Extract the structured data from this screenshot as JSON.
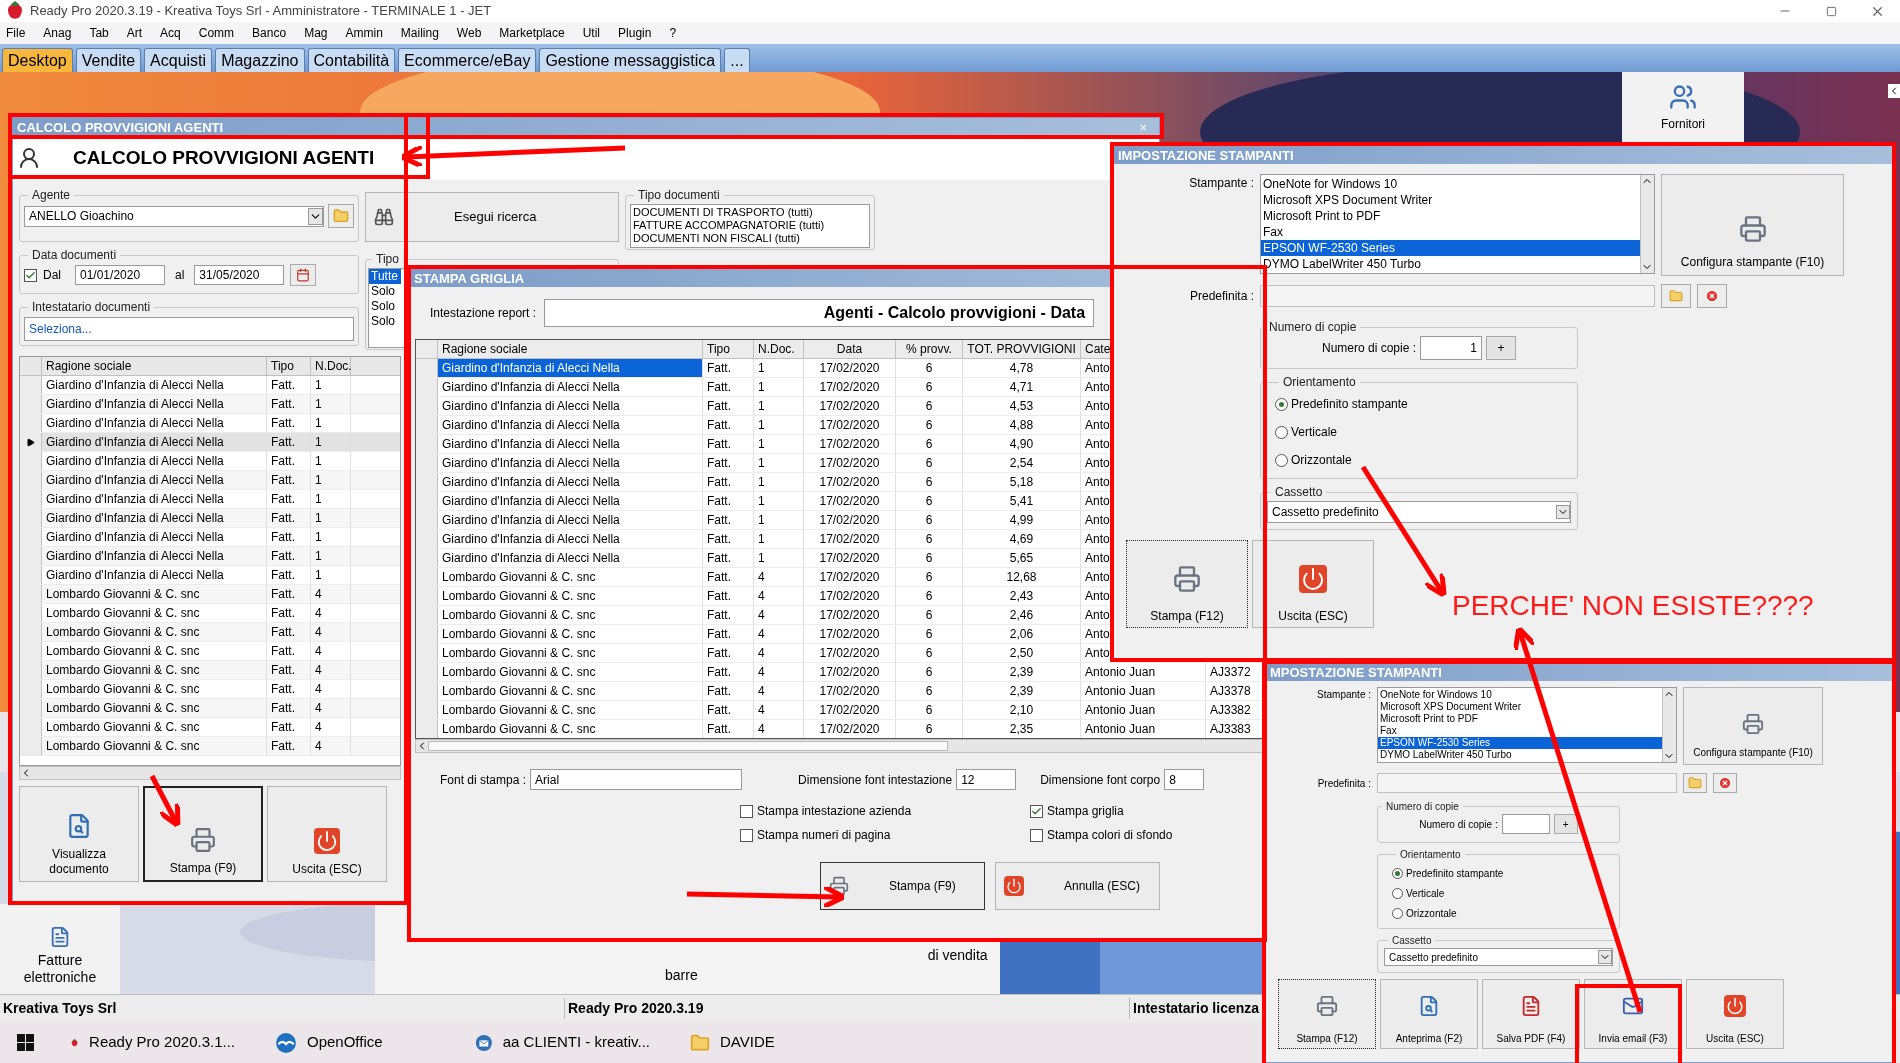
{
  "app_title": "Ready Pro 2020.3.19 - Kreativa Toys Srl - Amministratore - TERMINALE 1 - JET",
  "menu": [
    "File",
    "Anag",
    "Tab",
    "Art",
    "Acq",
    "Comm",
    "Banco",
    "Mag",
    "Ammin",
    "Mailing",
    "Web",
    "Marketplace",
    "Util",
    "Plugin",
    "?"
  ],
  "tabs": [
    {
      "label": "Desktop",
      "selected": true
    },
    {
      "label": "Vendite",
      "selected": false
    },
    {
      "label": "Acquisti",
      "selected": false
    },
    {
      "label": "Magazzino",
      "selected": false
    },
    {
      "label": "Contabilità",
      "selected": false
    },
    {
      "label": "Ecommerce/eBay",
      "selected": false
    },
    {
      "label": "Gestione messaggistica",
      "selected": false
    },
    {
      "label": "...",
      "selected": false
    }
  ],
  "desktop_shortcuts": [
    {
      "label": "Fornitori",
      "kind": "suppliers"
    },
    {
      "label": "Fatture elettroniche",
      "kind": "invoices"
    }
  ],
  "desktop_labels": [
    "barre",
    "di vendita"
  ],
  "agent_window": {
    "title": "CALCOLO PROVVIGIONI AGENTI",
    "close": "×",
    "heading": "CALCOLO PROVVIGIONI AGENTI",
    "agent_group": "Agente",
    "agent_value": "ANELLO Gioachino",
    "search_button": "Esegui ricerca",
    "doc_types_group": "Tipo documenti",
    "doc_types": [
      "DOCUMENTI DI TRASPORTO (tutti)",
      "FATTURE ACCOMPAGNATORIE (tutti)",
      "DOCUMENTI NON FISCALI (tutti)"
    ],
    "date_group": "Data documenti",
    "date_from_label": "Dal",
    "date_from_checked": true,
    "date_from": "01/01/2020",
    "date_to_label": "al",
    "date_to": "31/05/2020",
    "type_group": "Tipo",
    "types": [
      {
        "label": "Tutte",
        "selected": true
      },
      {
        "label": "Solo",
        "selected": false
      },
      {
        "label": "Solo",
        "selected": false
      },
      {
        "label": "Solo",
        "selected": false
      }
    ],
    "holder_group": "Intestatario documenti",
    "holder_placeholder": "Seleziona...",
    "grid": {
      "columns": [
        "Ragione sociale",
        "Tipo",
        "N.Doc."
      ],
      "rows": [
        {
          "cells": [
            "Giardino d'Infanzia di Alecci Nella",
            "Fatt.",
            "1"
          ],
          "selected": false
        },
        {
          "cells": [
            "Giardino d'Infanzia di Alecci Nella",
            "Fatt.",
            "1"
          ],
          "selected": false
        },
        {
          "cells": [
            "Giardino d'Infanzia di Alecci Nella",
            "Fatt.",
            "1"
          ],
          "selected": false
        },
        {
          "cells": [
            "Giardino d'Infanzia di Alecci Nella",
            "Fatt.",
            "1"
          ],
          "selected": true
        },
        {
          "cells": [
            "Giardino d'Infanzia di Alecci Nella",
            "Fatt.",
            "1"
          ],
          "selected": false
        },
        {
          "cells": [
            "Giardino d'Infanzia di Alecci Nella",
            "Fatt.",
            "1"
          ],
          "selected": false
        },
        {
          "cells": [
            "Giardino d'Infanzia di Alecci Nella",
            "Fatt.",
            "1"
          ],
          "selected": false
        },
        {
          "cells": [
            "Giardino d'Infanzia di Alecci Nella",
            "Fatt.",
            "1"
          ],
          "selected": false
        },
        {
          "cells": [
            "Giardino d'Infanzia di Alecci Nella",
            "Fatt.",
            "1"
          ],
          "selected": false
        },
        {
          "cells": [
            "Giardino d'Infanzia di Alecci Nella",
            "Fatt.",
            "1"
          ],
          "selected": false
        },
        {
          "cells": [
            "Giardino d'Infanzia di Alecci Nella",
            "Fatt.",
            "1"
          ],
          "selected": false
        },
        {
          "cells": [
            "Lombardo Giovanni & C. snc",
            "Fatt.",
            "4"
          ],
          "selected": false
        },
        {
          "cells": [
            "Lombardo Giovanni & C. snc",
            "Fatt.",
            "4"
          ],
          "selected": false
        },
        {
          "cells": [
            "Lombardo Giovanni & C. snc",
            "Fatt.",
            "4"
          ],
          "selected": false
        },
        {
          "cells": [
            "Lombardo Giovanni & C. snc",
            "Fatt.",
            "4"
          ],
          "selected": false
        },
        {
          "cells": [
            "Lombardo Giovanni & C. snc",
            "Fatt.",
            "4"
          ],
          "selected": false
        },
        {
          "cells": [
            "Lombardo Giovanni & C. snc",
            "Fatt.",
            "4"
          ],
          "selected": false
        },
        {
          "cells": [
            "Lombardo Giovanni & C. snc",
            "Fatt.",
            "4"
          ],
          "selected": false
        },
        {
          "cells": [
            "Lombardo Giovanni & C. snc",
            "Fatt.",
            "4"
          ],
          "selected": false
        },
        {
          "cells": [
            "Lombardo Giovanni & C. snc",
            "Fatt.",
            "4"
          ],
          "selected": false
        }
      ]
    },
    "buttons": [
      {
        "label": "Visualizza documento",
        "kind": "preview",
        "focused": false
      },
      {
        "label": "Stampa (F9)",
        "kind": "print",
        "focused": true
      },
      {
        "label": "Uscita (ESC)",
        "kind": "exit",
        "focused": false
      }
    ]
  },
  "print_grid_window": {
    "title": "STAMPA GRIGLIA",
    "report_label": "Intestazione report :",
    "report_value": "Agenti - Calcolo provvigioni - Data",
    "columns": [
      "Ragione sociale",
      "Tipo",
      "N.Doc.",
      "Data",
      "% provv.",
      "TOT. PROVVIGIONI",
      "Cate"
    ],
    "rows": [
      {
        "cells": [
          "Giardino d'Infanzia di Alecci Nella",
          "Fatt.",
          "1",
          "17/02/2020",
          "6",
          "4,78",
          "Anto"
        ],
        "selected": true
      },
      {
        "cells": [
          "Giardino d'Infanzia di Alecci Nella",
          "Fatt.",
          "1",
          "17/02/2020",
          "6",
          "4,71",
          "Anto"
        ],
        "selected": false
      },
      {
        "cells": [
          "Giardino d'Infanzia di Alecci Nella",
          "Fatt.",
          "1",
          "17/02/2020",
          "6",
          "4,53",
          "Anto"
        ],
        "selected": false
      },
      {
        "cells": [
          "Giardino d'Infanzia di Alecci Nella",
          "Fatt.",
          "1",
          "17/02/2020",
          "6",
          "4,88",
          "Anto"
        ],
        "selected": false
      },
      {
        "cells": [
          "Giardino d'Infanzia di Alecci Nella",
          "Fatt.",
          "1",
          "17/02/2020",
          "6",
          "4,90",
          "Anto"
        ],
        "selected": false
      },
      {
        "cells": [
          "Giardino d'Infanzia di Alecci Nella",
          "Fatt.",
          "1",
          "17/02/2020",
          "6",
          "2,54",
          "Anto"
        ],
        "selected": false
      },
      {
        "cells": [
          "Giardino d'Infanzia di Alecci Nella",
          "Fatt.",
          "1",
          "17/02/2020",
          "6",
          "5,18",
          "Anto"
        ],
        "selected": false
      },
      {
        "cells": [
          "Giardino d'Infanzia di Alecci Nella",
          "Fatt.",
          "1",
          "17/02/2020",
          "6",
          "5,41",
          "Anto"
        ],
        "selected": false
      },
      {
        "cells": [
          "Giardino d'Infanzia di Alecci Nella",
          "Fatt.",
          "1",
          "17/02/2020",
          "6",
          "4,99",
          "Anto"
        ],
        "selected": false
      },
      {
        "cells": [
          "Giardino d'Infanzia di Alecci Nella",
          "Fatt.",
          "1",
          "17/02/2020",
          "6",
          "4,69",
          "Anto"
        ],
        "selected": false
      },
      {
        "cells": [
          "Giardino d'Infanzia di Alecci Nella",
          "Fatt.",
          "1",
          "17/02/2020",
          "6",
          "5,65",
          "Anto"
        ],
        "selected": false
      },
      {
        "cells": [
          "Lombardo Giovanni & C. snc",
          "Fatt.",
          "4",
          "17/02/2020",
          "6",
          "12,68",
          "Anto"
        ],
        "selected": false
      },
      {
        "cells": [
          "Lombardo Giovanni & C. snc",
          "Fatt.",
          "4",
          "17/02/2020",
          "6",
          "2,43",
          "Anto"
        ],
        "selected": false
      },
      {
        "cells": [
          "Lombardo Giovanni & C. snc",
          "Fatt.",
          "4",
          "17/02/2020",
          "6",
          "2,46",
          "Anto"
        ],
        "selected": false
      },
      {
        "cells": [
          "Lombardo Giovanni & C. snc",
          "Fatt.",
          "4",
          "17/02/2020",
          "6",
          "2,06",
          "Anto"
        ],
        "selected": false
      },
      {
        "cells": [
          "Lombardo Giovanni & C. snc",
          "Fatt.",
          "4",
          "17/02/2020",
          "6",
          "2,50",
          "Anto"
        ],
        "selected": false
      },
      {
        "cells": [
          "Lombardo Giovanni & C. snc",
          "Fatt.",
          "4",
          "17/02/2020",
          "6",
          "2,39",
          "Antonio Juan"
        ],
        "code": "AJ3372",
        "selected": false
      },
      {
        "cells": [
          "Lombardo Giovanni & C. snc",
          "Fatt.",
          "4",
          "17/02/2020",
          "6",
          "2,39",
          "Antonio Juan"
        ],
        "code": "AJ3378",
        "selected": false
      },
      {
        "cells": [
          "Lombardo Giovanni & C. snc",
          "Fatt.",
          "4",
          "17/02/2020",
          "6",
          "2,10",
          "Antonio Juan"
        ],
        "code": "AJ3382",
        "selected": false
      },
      {
        "cells": [
          "Lombardo Giovanni & C. snc",
          "Fatt.",
          "4",
          "17/02/2020",
          "6",
          "2,35",
          "Antonio Juan"
        ],
        "code": "AJ3383",
        "selected": false
      }
    ],
    "font_label": "Font di stampa :",
    "font_value": "Arial",
    "header_size_label": "Dimensione font intestazione",
    "header_size": "12",
    "body_size_label": "Dimensione font corpo",
    "body_size": "8",
    "options": [
      {
        "label": "Stampa intestazione azienda",
        "checked": false
      },
      {
        "label": "Stampa numeri di pagina",
        "checked": false
      },
      {
        "label": "Stampa griglia",
        "checked": true
      },
      {
        "label": "Stampa colori di sfondo",
        "checked": false
      }
    ],
    "buttons": [
      {
        "label": "Stampa (F9)",
        "kind": "print"
      },
      {
        "label": "Annulla (ESC)",
        "kind": "exit"
      }
    ]
  },
  "printer_dialogs": [
    {
      "title": "IMPOSTAZIONE STAMPANTI",
      "printer_label": "Stampante :",
      "printers": [
        {
          "name": "OneNote for Windows 10",
          "selected": false
        },
        {
          "name": "Microsoft XPS Document Writer",
          "selected": false
        },
        {
          "name": "Microsoft Print to PDF",
          "selected": false
        },
        {
          "name": "Fax",
          "selected": false
        },
        {
          "name": "EPSON WF-2530 Series",
          "selected": true
        },
        {
          "name": "DYMO LabelWriter 450 Turbo",
          "selected": false
        }
      ],
      "configure_button": "Configura stampante (F10)",
      "default_label": "Predefinita :",
      "copies_group": "Numero di copie",
      "copies_label": "Numero di copie :",
      "copies_value": "1",
      "plus_button": "+",
      "orientation_group": "Orientamento",
      "orientations": [
        {
          "label": "Predefinito stampante",
          "selected": true
        },
        {
          "label": "Verticale",
          "selected": false
        },
        {
          "label": "Orizzontale",
          "selected": false
        }
      ],
      "tray_group": "Cassetto",
      "tray_value": "Cassetto predefinito",
      "buttons": [
        {
          "label": "Stampa (F12)",
          "kind": "print"
        },
        {
          "label": "Uscita (ESC)",
          "kind": "exit"
        }
      ]
    },
    {
      "title": "MPOSTAZIONE STAMPANTI",
      "printer_label": "Stampante :",
      "printers": [
        {
          "name": "OneNote for Windows 10",
          "selected": false
        },
        {
          "name": "Microsoft XPS Document Writer",
          "selected": false
        },
        {
          "name": "Microsoft Print to PDF",
          "selected": false
        },
        {
          "name": "Fax",
          "selected": false
        },
        {
          "name": "EPSON WF-2530 Series",
          "selected": true
        },
        {
          "name": "DYMO LabelWriter 450 Turbo",
          "selected": false
        }
      ],
      "configure_button": "Configura stampante (F10)",
      "default_label": "Predefinita :",
      "copies_group": "Numero di copie",
      "copies_label": "Numero di copie :",
      "plus_button": "+",
      "orientation_group": "Orientamento",
      "orientations": [
        {
          "label": "Predefinito stampante",
          "selected": true
        },
        {
          "label": "Verticale",
          "selected": false
        },
        {
          "label": "Orizzontale",
          "selected": false
        }
      ],
      "tray_group": "Cassetto",
      "tray_value": "Cassetto predefinito",
      "buttons": [
        {
          "label": "Stampa (F12)",
          "kind": "print"
        },
        {
          "label": "Anteprima (F2)",
          "kind": "preview"
        },
        {
          "label": "Salva PDF (F4)",
          "kind": "pdf"
        },
        {
          "label": "Invia email (F3)",
          "kind": "email"
        },
        {
          "label": "Uscita (ESC)",
          "kind": "exit"
        }
      ]
    }
  ],
  "annotation": "PERCHE' NON ESISTE????",
  "status_bar": [
    "Kreativa Toys Srl",
    "Ready Pro 2020.3.19",
    "Intestatario licenza"
  ],
  "taskbar": [
    {
      "label": "Ready Pro 2020.3.1...",
      "kind": "app"
    },
    {
      "label": "OpenOffice",
      "kind": "office"
    },
    {
      "label": "aa CLIENTI - kreativ...",
      "kind": "mail"
    },
    {
      "label": "DAVIDE",
      "kind": "folder"
    }
  ]
}
